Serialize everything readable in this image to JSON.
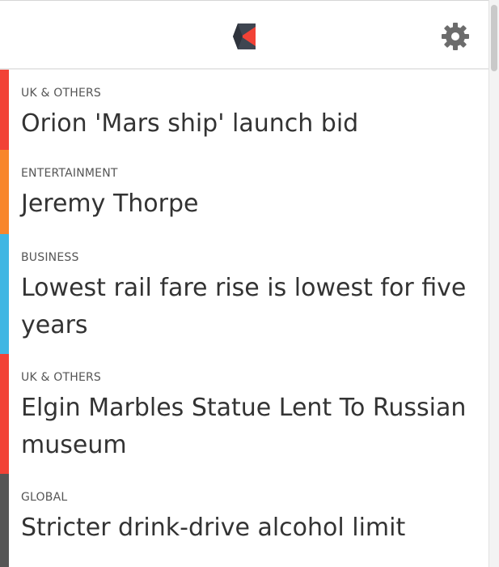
{
  "header": {
    "logo_icon": "app-logo-icon",
    "settings_icon": "gear-icon"
  },
  "colors": {
    "uk_others": "#f24236",
    "entertainment": "#f8862b",
    "business": "#3fb6e3",
    "global": "#555555",
    "logo_dark": "#3f4651",
    "logo_red": "#f24236",
    "gear": "#6c6c6c"
  },
  "feed": {
    "items": [
      {
        "category": "UK & OTHERS",
        "headline": "Orion 'Mars ship' launch bid",
        "color": "#f24236"
      },
      {
        "category": "ENTERTAINMENT",
        "headline": "Jeremy Thorpe",
        "color": "#f8862b"
      },
      {
        "category": "BUSINESS",
        "headline": "Lowest rail fare rise is lowest for five years",
        "color": "#3fb6e3"
      },
      {
        "category": "UK & OTHERS",
        "headline": "Elgin Marbles Statue Lent To Russian museum",
        "color": "#f24236"
      },
      {
        "category": "GLOBAL",
        "headline": "Stricter drink-drive alcohol limit",
        "color": "#555555"
      }
    ]
  }
}
